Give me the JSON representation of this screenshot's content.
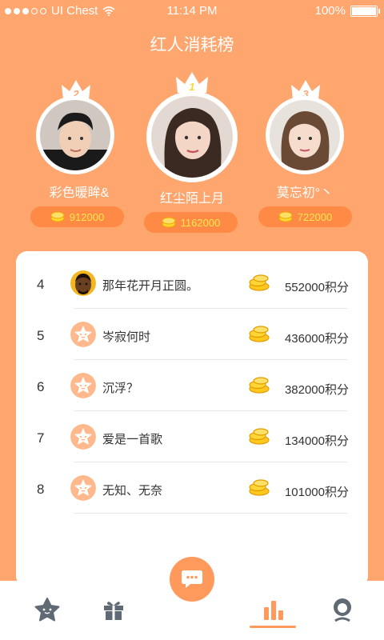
{
  "status_bar": {
    "carrier": "UI Chest",
    "time": "11:14 PM",
    "battery": "100%"
  },
  "page_title": "红人消耗榜",
  "podium": [
    {
      "rank": "2",
      "name": "彩色暖眸&",
      "score": "912000"
    },
    {
      "rank": "1",
      "name": "红尘陌上月",
      "score": "1162000"
    },
    {
      "rank": "3",
      "name": "莫忘初°丶",
      "score": "722000"
    }
  ],
  "list": [
    {
      "rank": "4",
      "name": "那年花开月正圆。",
      "score": "552000积分",
      "avatar": "photo"
    },
    {
      "rank": "5",
      "name": "岑寂何时",
      "score": "436000积分",
      "avatar": "star-face"
    },
    {
      "rank": "6",
      "name": "沉浮？",
      "score": "382000积分",
      "avatar": "star-face"
    },
    {
      "rank": "7",
      "name": "爱是一首歌",
      "score": "134000积分",
      "avatar": "star-face"
    },
    {
      "rank": "8",
      "name": "无知、无奈",
      "score": "101000积分",
      "avatar": "star-face"
    }
  ],
  "tabs": [
    "star-icon",
    "gift-icon",
    "chat-icon",
    "ranking-icon",
    "profile-icon"
  ],
  "colors": {
    "background": "#ffa56e",
    "accent": "#ff9a5c",
    "coin": "#ffd633",
    "pill": "#ff8a45"
  }
}
